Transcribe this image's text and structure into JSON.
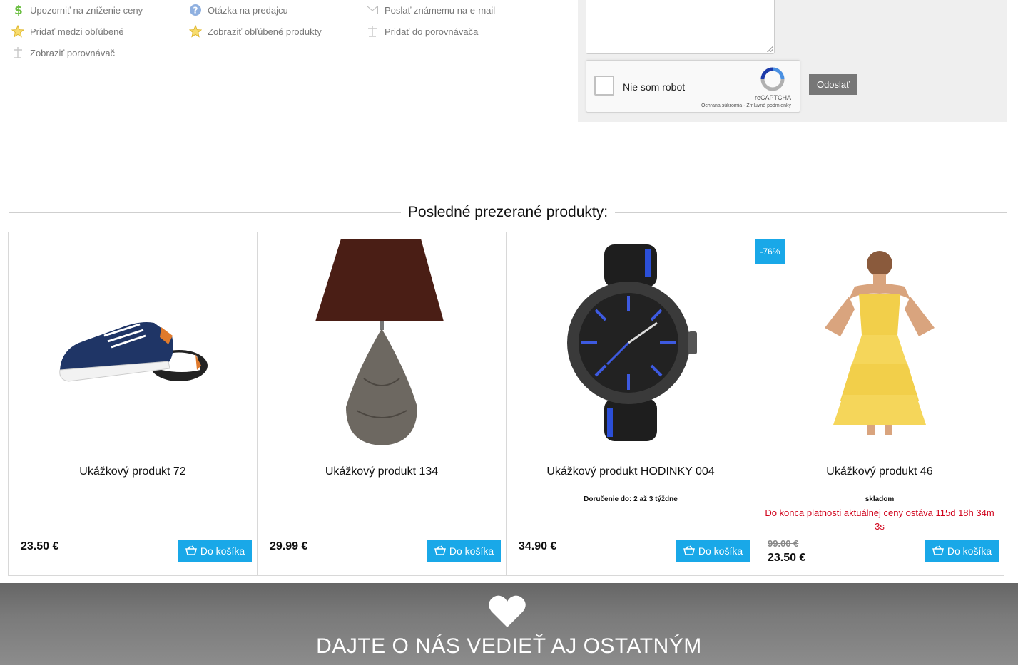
{
  "actions": [
    {
      "label": "Upozorniť na zníženie ceny",
      "icon": "dollar-icon"
    },
    {
      "label": "Otázka na predajcu",
      "icon": "question-icon"
    },
    {
      "label": "Poslať známemu na e-mail",
      "icon": "envelope-icon"
    },
    {
      "label": "Pridať medzi obľúbené",
      "icon": "star-icon"
    },
    {
      "label": "Zobraziť obľúbené produkty",
      "icon": "star-icon"
    },
    {
      "label": "Pridať do porovnávača",
      "icon": "compare-icon"
    },
    {
      "label": "Zobraziť porovnávač",
      "icon": "compare-icon"
    }
  ],
  "form": {
    "recaptcha_label": "Nie som robot",
    "recaptcha_brand": "reCAPTCHA",
    "recaptcha_links": "Ochrana súkromia - Zmluvné podmienky",
    "send_label": "Odoslať"
  },
  "recent": {
    "title": "Posledné prezerané produkty:",
    "cart_label": "Do košíka",
    "products": [
      {
        "name": "Ukážkový produkt 72",
        "price": "23.50 €",
        "image": "sneaker"
      },
      {
        "name": "Ukážkový produkt 134",
        "price": "29.99 €",
        "image": "lamp"
      },
      {
        "name": "Ukážkový produkt HODINKY 004",
        "price": "34.90 €",
        "delivery": "Doručenie do: 2 až 3 týždne",
        "image": "watch"
      },
      {
        "name": "Ukážkový produkt 46",
        "price": "23.50 €",
        "old_price": "99.00 €",
        "badge": "-76%",
        "stock": "skladom",
        "countdown": "Do konca platnosti aktuálnej ceny ostáva 115d 18h 34m 3s",
        "image": "dress"
      }
    ]
  },
  "footer": {
    "share_title": "DAJTE O NÁS VEDIEŤ AJ OSTATNÝM",
    "icon": "heart-icon"
  },
  "colors": {
    "accent": "#19a8e8",
    "countdown": "#d0021b",
    "send_button": "#777777"
  }
}
